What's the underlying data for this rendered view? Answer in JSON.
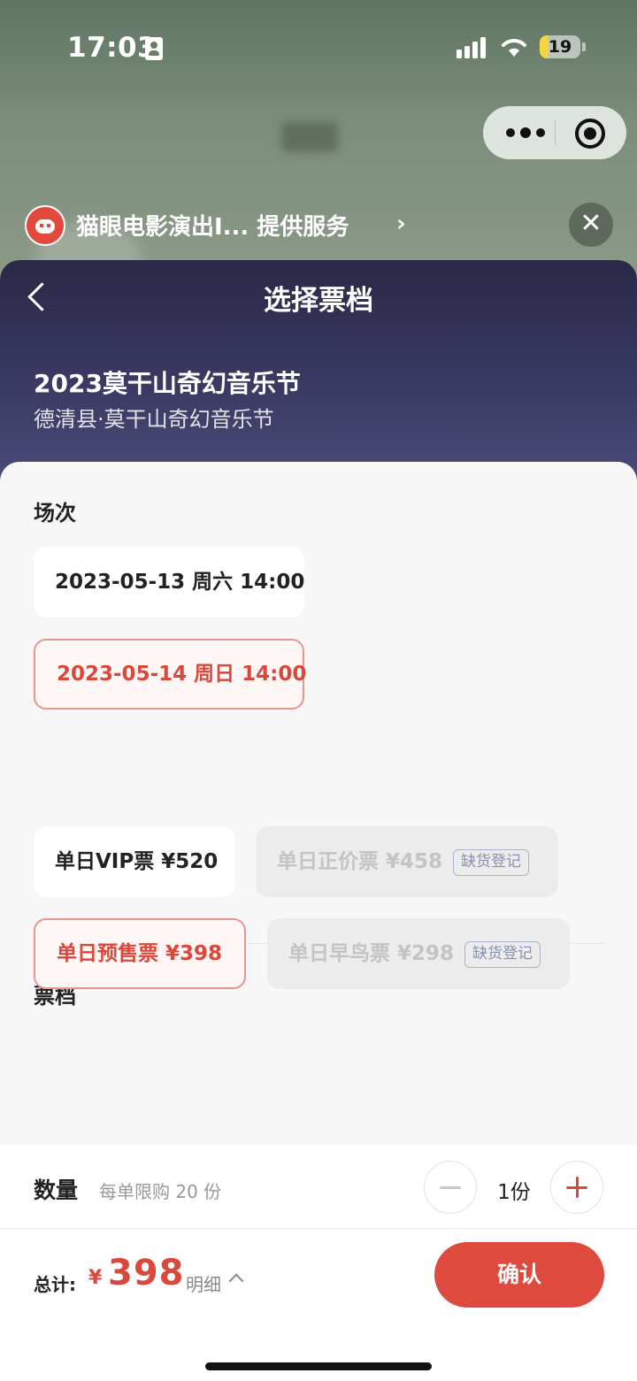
{
  "status_bar": {
    "time": "17:03",
    "battery": "19"
  },
  "provider": {
    "text": "猫眼电影演出I... 提供服务",
    "chevron": "›",
    "close": "✕"
  },
  "header": {
    "title": "选择票档",
    "event_title": "2023莫干山奇幻音乐节",
    "event_venue": "德清县·莫干山奇幻音乐节"
  },
  "sessions": {
    "label": "场次",
    "items": [
      {
        "label": "2023-05-13 周六 14:00",
        "selected": false
      },
      {
        "label": "2023-05-14 周日 14:00",
        "selected": true
      }
    ]
  },
  "tickets": {
    "label": "票档",
    "items": [
      {
        "label": "单日VIP票 ¥520",
        "selected": false,
        "disabled": false
      },
      {
        "label": "单日正价票 ¥458",
        "selected": false,
        "disabled": true,
        "tag": "缺货登记"
      },
      {
        "label": "单日预售票 ¥398",
        "selected": true,
        "disabled": false
      },
      {
        "label": "单日早鸟票 ¥298",
        "selected": false,
        "disabled": true,
        "tag": "缺货登记"
      }
    ]
  },
  "quantity": {
    "label": "数量",
    "limit": "每单限购 20 份",
    "value": "1份"
  },
  "footer": {
    "total_label": "总计:",
    "currency": "¥",
    "amount": "398",
    "detail": "明细",
    "confirm": "确认"
  },
  "colors": {
    "accent": "#de4b3e",
    "header_bg": "#2a2947"
  }
}
